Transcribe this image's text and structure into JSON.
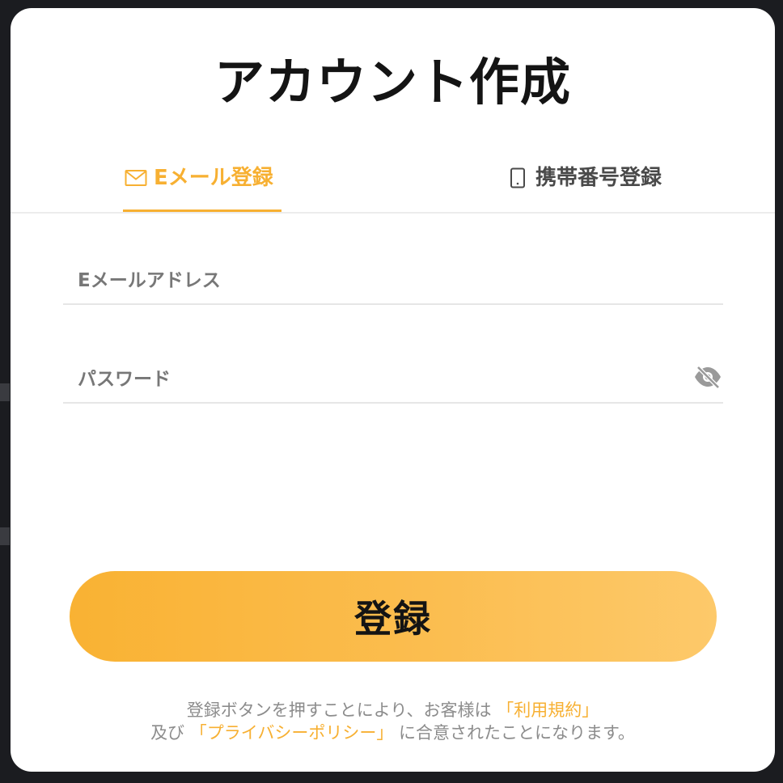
{
  "page": {
    "title": "アカウント作成"
  },
  "tabs": [
    {
      "label": "Eメール登録",
      "icon": "mail-icon",
      "active": true
    },
    {
      "label": "携帯番号登録",
      "icon": "phone-icon",
      "active": false
    }
  ],
  "form": {
    "email_placeholder": "Eメールアドレス",
    "email_value": "",
    "password_placeholder": "パスワード",
    "password_value": "",
    "password_toggle_icon": "eye-off-icon"
  },
  "submit": {
    "label": "登録"
  },
  "terms": {
    "line1_text": "登録ボタンを押すことにより、お客様は",
    "terms_link": "「利用規約」",
    "line2_prefix": "及び",
    "privacy_link": "「プライバシーポリシー」",
    "line2_suffix": "に合意されたことになります。"
  },
  "colors": {
    "accent": "#f7b032",
    "background": "#1b1c20",
    "modal": "#ffffff",
    "text_dark": "#141414",
    "text_muted": "#8c8c8c"
  }
}
